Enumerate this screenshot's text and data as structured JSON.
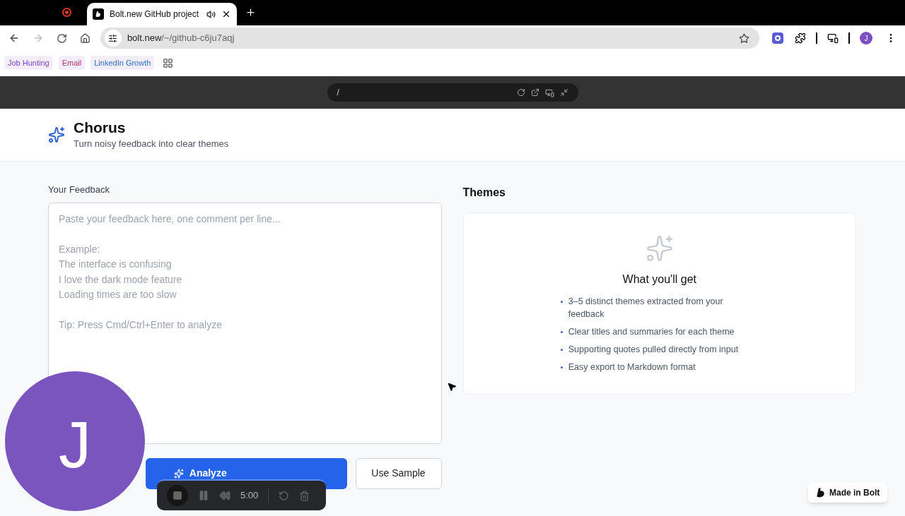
{
  "browser": {
    "tab": {
      "title": "Bolt.new GitHub project",
      "selected": true
    },
    "address": {
      "host": "bolt.new",
      "path": "/~/github-c6ju7aqj"
    },
    "profile_initial": "J",
    "bookmarks": [
      {
        "label": "Job Hunting",
        "color": "#7b3fbf"
      },
      {
        "label": "Email",
        "color": "#b0306a"
      },
      {
        "label": "LinkedIn Growth",
        "color": "#2f6fc0"
      }
    ]
  },
  "preview_bar": {
    "path": "/"
  },
  "app": {
    "title": "Chorus",
    "subtitle": "Turn noisy feedback into clear themes"
  },
  "feedback": {
    "label": "Your Feedback",
    "placeholder": "Paste your feedback here, one comment per line...\n\nExample:\nThe interface is confusing\nI love the dark mode feature\nLoading times are too slow\n\nTip: Press Cmd/Ctrl+Enter to analyze"
  },
  "buttons": {
    "analyze": "Analyze",
    "sample": "Use Sample"
  },
  "themes": {
    "heading": "Themes",
    "empty_title": "What you'll get",
    "items": [
      "3–5 distinct themes extracted from your feedback",
      "Clear titles and summaries for each theme",
      "Supporting quotes pulled directly from input",
      "Easy export to Markdown format"
    ]
  },
  "badge": "Made in Bolt",
  "recorder": {
    "time": "5:00"
  },
  "avatar_initial": "J"
}
